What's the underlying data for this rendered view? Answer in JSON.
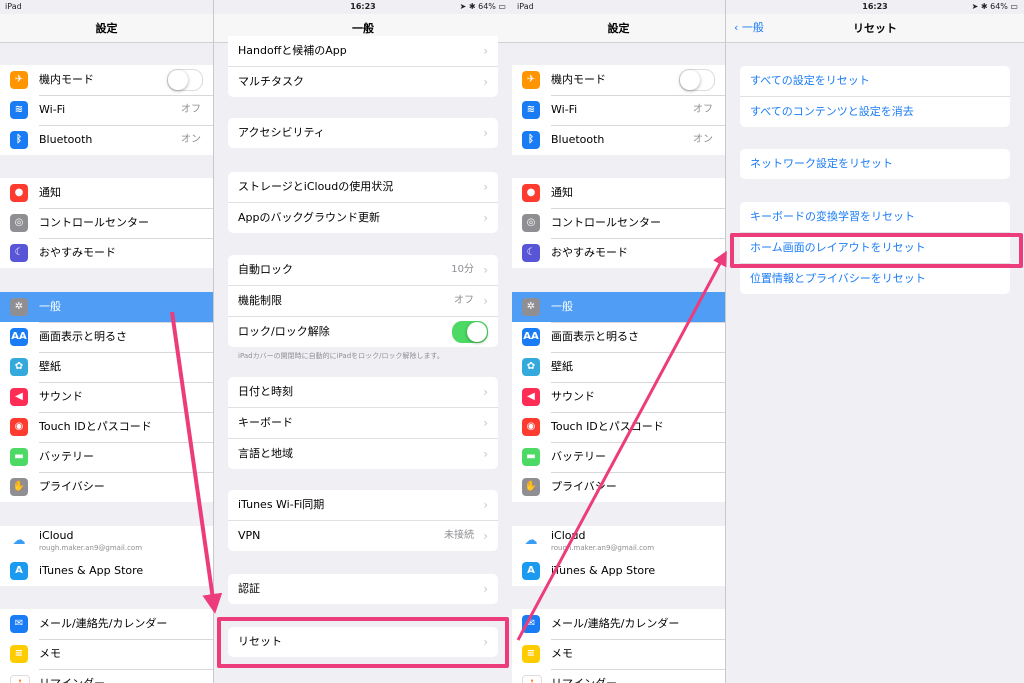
{
  "status": {
    "carrier": "iPad",
    "time": "16:23",
    "battery": "64%"
  },
  "settings_panel": {
    "title": "設定",
    "group1": [
      {
        "label": "機内モード",
        "icon": "airplane-icon",
        "color": "#ff9500"
      },
      {
        "label": "Wi-Fi",
        "value": "オフ",
        "icon": "wifi-icon",
        "color": "#1a7cf5"
      },
      {
        "label": "Bluetooth",
        "value": "オン",
        "icon": "bluetooth-icon",
        "color": "#1a7cf5"
      }
    ],
    "group2": [
      {
        "label": "通知",
        "icon": "notifications-icon",
        "color": "#ff3b30"
      },
      {
        "label": "コントロールセンター",
        "icon": "control-center-icon",
        "color": "#8e8e93"
      },
      {
        "label": "おやすみモード",
        "icon": "moon-icon",
        "color": "#5856d6"
      }
    ],
    "group3": [
      {
        "label": "一般",
        "icon": "gear-icon",
        "color": "#8e8e93"
      },
      {
        "label": "画面表示と明るさ",
        "icon": "display-icon",
        "color": "#1a7cf5",
        "glyph": "AA"
      },
      {
        "label": "壁紙",
        "icon": "wallpaper-icon",
        "color": "#34aadc"
      },
      {
        "label": "サウンド",
        "icon": "sound-icon",
        "color": "#ff2d55"
      },
      {
        "label": "Touch IDとパスコード",
        "icon": "fingerprint-icon",
        "color": "#ff3b30"
      },
      {
        "label": "バッテリー",
        "icon": "battery-icon",
        "color": "#4cd964"
      },
      {
        "label": "プライバシー",
        "icon": "hand-icon",
        "color": "#8e8e93"
      }
    ],
    "icloud": {
      "label": "iCloud",
      "sub": "rough.maker.an9@gmail.com"
    },
    "itunes": {
      "label": "iTunes & App Store"
    },
    "group5": [
      {
        "label": "メール/連絡先/カレンダー",
        "icon": "mail-icon",
        "color": "#1a7cf5"
      },
      {
        "label": "メモ",
        "icon": "notes-icon",
        "color": "#ffcc00"
      },
      {
        "label": "リマインダー",
        "icon": "reminders-icon",
        "color": "#ffffff"
      }
    ]
  },
  "general_panel": {
    "title": "一般",
    "g1": [
      {
        "label": "Handoffと候補のApp"
      },
      {
        "label": "マルチタスク"
      }
    ],
    "g2": [
      {
        "label": "アクセシビリティ"
      }
    ],
    "g3": [
      {
        "label": "ストレージとiCloudの使用状況"
      },
      {
        "label": "Appのバックグラウンド更新"
      }
    ],
    "g4": [
      {
        "label": "自動ロック",
        "value": "10分"
      },
      {
        "label": "機能制限",
        "value": "オフ"
      },
      {
        "label": "ロック/ロック解除"
      }
    ],
    "g4_footer": "iPadカバーの開閉時に自動的にiPadをロック/ロック解除します。",
    "g5": [
      {
        "label": "日付と時刻"
      },
      {
        "label": "キーボード"
      },
      {
        "label": "言語と地域"
      }
    ],
    "g6": [
      {
        "label": "iTunes Wi-Fi同期"
      },
      {
        "label": "VPN",
        "value": "未接続"
      }
    ],
    "g7": [
      {
        "label": "認証"
      }
    ],
    "g8": [
      {
        "label": "リセット"
      }
    ]
  },
  "reset_panel": {
    "back": "一般",
    "title": "リセット",
    "g1": [
      {
        "label": "すべての設定をリセット"
      },
      {
        "label": "すべてのコンテンツと設定を消去"
      }
    ],
    "g2": [
      {
        "label": "ネットワーク設定をリセット"
      }
    ],
    "g3": [
      {
        "label": "キーボードの変換学習をリセット"
      },
      {
        "label": "ホーム画面のレイアウトをリセット"
      },
      {
        "label": "位置情報とプライバシーをリセット"
      }
    ]
  },
  "highlight_color": "#ec3c7a"
}
